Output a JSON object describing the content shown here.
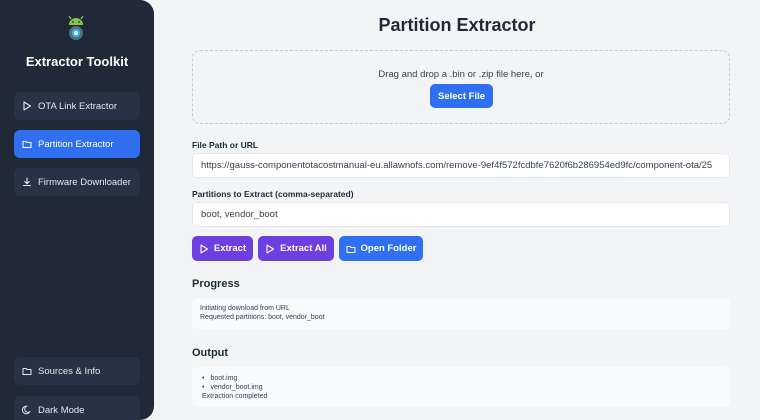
{
  "sidebar": {
    "app_title": "Extractor Toolkit",
    "logo_icon": "android-gear-logo",
    "items": [
      {
        "label": "OTA Link Extractor",
        "icon": "play-icon",
        "active": false
      },
      {
        "label": "Partition Extractor",
        "icon": "folder-icon",
        "active": true
      },
      {
        "label": "Firmware Downloader",
        "icon": "download-icon",
        "active": false
      }
    ],
    "bottom_items": [
      {
        "label": "Sources & Info",
        "icon": "folder-icon"
      },
      {
        "label": "Dark Mode",
        "icon": "moon-icon"
      }
    ]
  },
  "main": {
    "title": "Partition Extractor",
    "dropzone": {
      "text": "Drag and drop a .bin or .zip file here, or",
      "button_label": "Select File"
    },
    "file_path": {
      "label": "File Path or URL",
      "value": "https://gauss-componentotacostmanual-eu.allawnofs.com/remove-9ef4f572fcdbfe7620f6b286954ed9fc/component-ota/25"
    },
    "partitions": {
      "label": "Partitions to Extract (comma-separated)",
      "value": "boot, vendor_boot"
    },
    "actions": {
      "extract_label": "Extract",
      "extract_all_label": "Extract All",
      "open_folder_label": "Open Folder"
    },
    "progress": {
      "title": "Progress",
      "lines": [
        "Initiating download from URL",
        "Requested partitions: boot, vendor_boot"
      ]
    },
    "output": {
      "title": "Output",
      "files": [
        "boot.img",
        "vendor_boot.img"
      ],
      "status": "Extraction completed"
    }
  },
  "colors": {
    "sidebar_bg": "#1f2937",
    "accent_blue": "#2f6ff0",
    "accent_purple": "#6d3fe0",
    "page_bg": "#f3f4f6"
  }
}
